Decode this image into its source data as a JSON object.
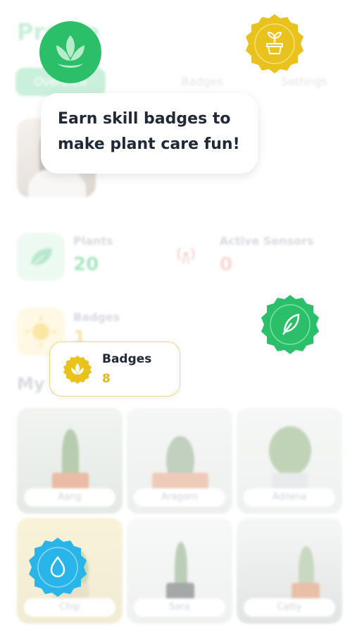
{
  "header": {
    "title": "Profile"
  },
  "tabs": [
    {
      "label": "Overview",
      "active": true
    },
    {
      "label": "Badges",
      "active": false
    },
    {
      "label": "Settings",
      "active": false
    }
  ],
  "stats": {
    "plants": {
      "label": "Plants",
      "value": "20",
      "icon": "leaf-icon"
    },
    "sensors": {
      "label": "Active Sensors",
      "value": "0",
      "icon": "signal-icon"
    },
    "badges": {
      "label": "Badges",
      "value": "1",
      "icon": "sun-icon"
    }
  },
  "section_title": "My plants",
  "plants": [
    {
      "name": "Aang"
    },
    {
      "name": "Aragorn"
    },
    {
      "name": "Adilena"
    },
    {
      "name": "Chip"
    },
    {
      "name": "Sara"
    },
    {
      "name": "Catty"
    }
  ],
  "overlay": {
    "tooltip_line1": "Earn skill badges to",
    "tooltip_line2": "make plant care fun!",
    "badges_card_label": "Badges",
    "badges_card_count": "8"
  },
  "colors": {
    "green": "#2bbf6a",
    "yellow": "#e9c21e",
    "blue": "#29b4ea",
    "text": "#1f2937"
  }
}
